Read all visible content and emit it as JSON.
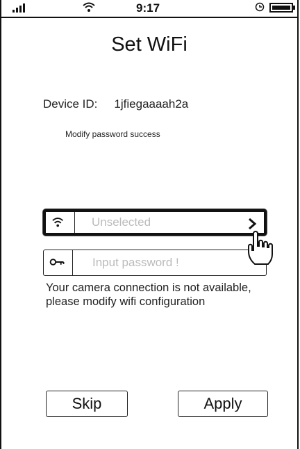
{
  "status_bar": {
    "time": "9:17",
    "icons": [
      "signal-bars-icon",
      "wifi-icon",
      "alarm-clock-icon",
      "battery-icon"
    ]
  },
  "header": {
    "title": "Set WiFi"
  },
  "device": {
    "label": "Device ID:",
    "value": "1jfiegaaaah2a"
  },
  "status_message": "Modify password success",
  "wifi_form": {
    "ssid_placeholder": "Unselected",
    "password_placeholder": "Input password !",
    "ssid_icon": "wifi-icon",
    "password_icon": "key-icon",
    "select_icon": "chevron-right-icon"
  },
  "warning_text": "Your camera connection is not available, please modify wifi configuration",
  "actions": {
    "skip_label": "Skip",
    "apply_label": "Apply"
  },
  "overlay_icon": "tap-hand-icon"
}
